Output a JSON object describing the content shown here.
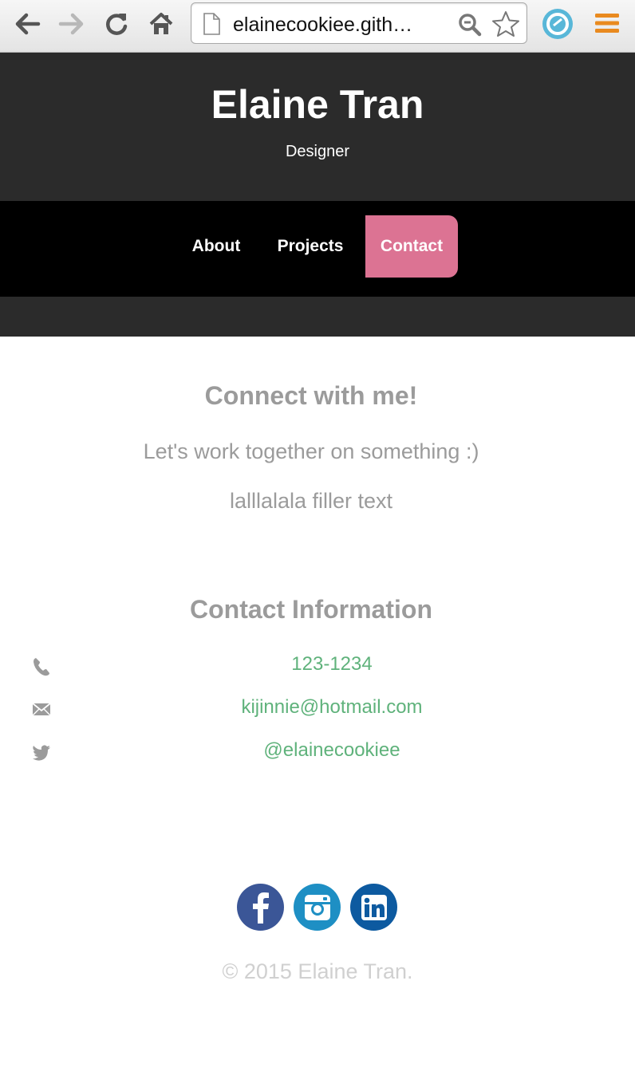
{
  "browser": {
    "url": "elainecookiee.gith…",
    "icons": [
      "back-arrow-icon",
      "forward-arrow-icon",
      "reload-icon",
      "home-icon",
      "page-icon",
      "zoom-icon",
      "star-icon",
      "extension-icon",
      "menu-icon"
    ]
  },
  "header": {
    "title": "Elaine Tran",
    "subtitle": "Designer"
  },
  "nav": {
    "items": [
      {
        "label": "About"
      },
      {
        "label": "Projects"
      },
      {
        "label": "Contact",
        "active": true
      }
    ],
    "active_color": "#dc7393"
  },
  "connect": {
    "heading": "Connect with me!",
    "line1": "Let's work together on something :)",
    "line2": "lalllalala filler text"
  },
  "contact_info": {
    "heading": "Contact Information",
    "phone": "123-1234",
    "email": "kijinnie@hotmail.com",
    "twitter": "@elainecookiee",
    "link_color": "#5fb27b"
  },
  "footer": {
    "social": [
      "facebook-icon",
      "instagram-icon",
      "linkedin-icon"
    ],
    "copyright": "© 2015 Elaine Tran."
  },
  "colors": {
    "header_bg": "#2b2b2b",
    "nav_bg": "#000000",
    "text_gray": "#9b9b9b"
  }
}
